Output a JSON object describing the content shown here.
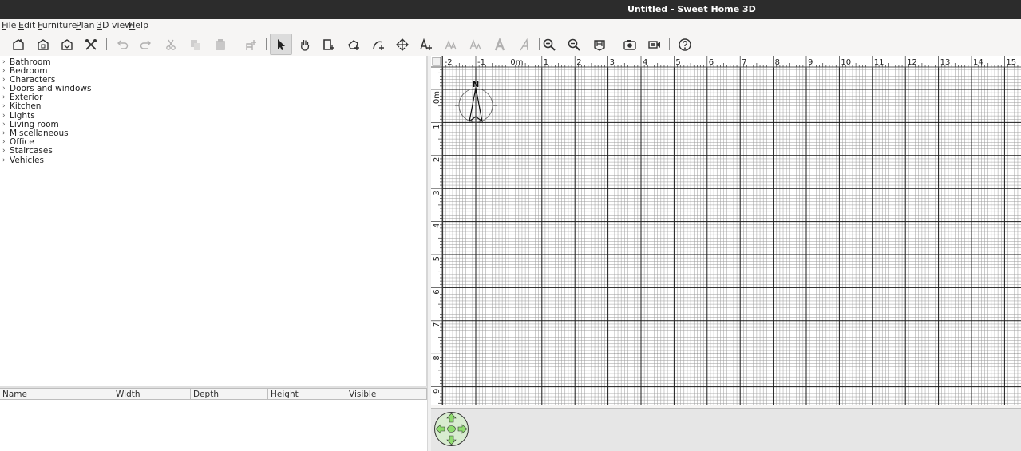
{
  "window": {
    "title": "Untitled - Sweet Home 3D"
  },
  "menu": [
    {
      "label": "File",
      "mnemonic": "F",
      "rest": "ile"
    },
    {
      "label": "Edit",
      "mnemonic": "E",
      "rest": "dit"
    },
    {
      "label": "Furniture",
      "mnemonic": "F",
      "rest": "urniture"
    },
    {
      "label": "Plan",
      "mnemonic": "P",
      "rest": "lan"
    },
    {
      "label": "3D view",
      "mnemonic": "3",
      "rest": "D view"
    },
    {
      "label": "Help",
      "mnemonic": "H",
      "rest": "elp"
    }
  ],
  "toolbar": {
    "buttons": [
      {
        "name": "new-home-icon",
        "enabled": true
      },
      {
        "name": "open-icon",
        "enabled": true
      },
      {
        "name": "save-icon",
        "enabled": true
      },
      {
        "name": "preferences-icon",
        "enabled": true
      },
      {
        "name": "undo-icon",
        "enabled": false
      },
      {
        "name": "redo-icon",
        "enabled": false
      },
      {
        "name": "cut-icon",
        "enabled": false
      },
      {
        "name": "copy-icon",
        "enabled": false
      },
      {
        "name": "paste-icon",
        "enabled": false
      },
      {
        "name": "add-furniture-icon",
        "enabled": false
      },
      {
        "name": "select-mode-icon",
        "enabled": true,
        "active": true
      },
      {
        "name": "pan-mode-icon",
        "enabled": true
      },
      {
        "name": "create-walls-icon",
        "enabled": true
      },
      {
        "name": "create-rooms-icon",
        "enabled": true
      },
      {
        "name": "create-polylines-icon",
        "enabled": true
      },
      {
        "name": "create-dimensions-icon",
        "enabled": true
      },
      {
        "name": "add-text-icon",
        "enabled": true
      },
      {
        "name": "increase-text-size-icon",
        "enabled": false
      },
      {
        "name": "decrease-text-size-icon",
        "enabled": false
      },
      {
        "name": "bold-text-icon",
        "enabled": false
      },
      {
        "name": "italic-text-icon",
        "enabled": false
      },
      {
        "name": "zoom-in-icon",
        "enabled": true
      },
      {
        "name": "zoom-out-icon",
        "enabled": true
      },
      {
        "name": "create-photo-icon",
        "enabled": true
      },
      {
        "name": "create-video-icon",
        "enabled": true
      },
      {
        "name": "help-icon",
        "enabled": true
      }
    ]
  },
  "catalog": {
    "categories": [
      "Bathroom",
      "Bedroom",
      "Characters",
      "Doors and windows",
      "Exterior",
      "Kitchen",
      "Lights",
      "Living room",
      "Miscellaneous",
      "Office",
      "Staircases",
      "Vehicles"
    ]
  },
  "furniture_table": {
    "columns": [
      "Name",
      "Width",
      "Depth",
      "Height",
      "Visible"
    ]
  },
  "plan": {
    "ruler_x_labels": [
      "-2",
      "-1",
      "0m",
      "1",
      "2",
      "3",
      "4",
      "5",
      "6",
      "7",
      "8",
      "9",
      "10",
      "11",
      "12",
      "13",
      "14",
      "15"
    ],
    "ruler_y_labels": [
      "0m",
      "1",
      "2",
      "3",
      "4",
      "5",
      "6",
      "7",
      "8",
      "9"
    ],
    "compass_label": "N"
  },
  "colors": {
    "titlebar_bg": "#2c2c2c",
    "grid_major": "#1a1a1a",
    "grid_minor": "#9a9a9a",
    "nav_green": "#8edc6e"
  }
}
